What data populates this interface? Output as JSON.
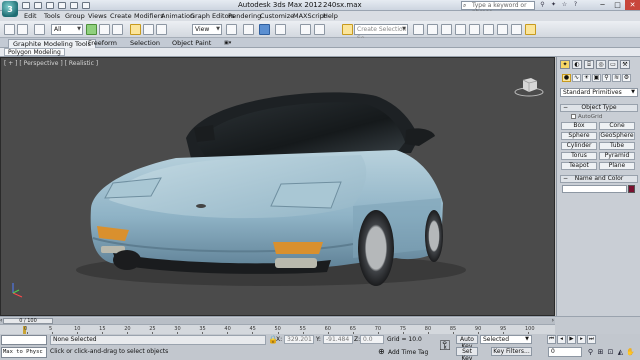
{
  "titlebar": {
    "app_title": "Autodesk 3ds Max 2012",
    "file_title": "240sx.max",
    "search_placeholder": "Type a keyword or phrase"
  },
  "menu": [
    "Edit",
    "Tools",
    "Group",
    "Views",
    "Create",
    "Modifiers",
    "Animation",
    "Graph Editors",
    "Rendering",
    "Customize",
    "MAXScript",
    "Help"
  ],
  "toolbar": {
    "filter_value": "All",
    "refcoord_value": "View",
    "named_selection_placeholder": "Create Selection Se"
  },
  "ribbon": {
    "tabs": [
      "Graphite Modeling Tools",
      "Freeform",
      "Selection",
      "Object Paint"
    ],
    "sub_label": "Polygon Modeling"
  },
  "viewport": {
    "label": "[ + ] [ Perspective ] [ Realistic ]",
    "car_color": "#8fb5c8"
  },
  "command_panel": {
    "category": "Standard Primitives",
    "object_type_header": "Object Type",
    "autogrid_label": "AutoGrid",
    "buttons": [
      "Box",
      "Cone",
      "Sphere",
      "GeoSphere",
      "Cylinder",
      "Tube",
      "Torus",
      "Pyramid",
      "Teapot",
      "Plane"
    ],
    "name_color_header": "Name and Color",
    "object_color": "#7a1030"
  },
  "timeline": {
    "slider_label": "0 / 100",
    "ticks": [
      "0",
      "5",
      "10",
      "15",
      "20",
      "25",
      "30",
      "35",
      "40",
      "45",
      "50",
      "55",
      "60",
      "65",
      "70",
      "75",
      "80",
      "85",
      "90",
      "95",
      "100"
    ]
  },
  "status": {
    "maxscript_label": "Max to Physc",
    "selection_status": "None Selected",
    "hint": "Click or click-and-drag to select objects",
    "x_label": "X:",
    "x_value": "329.201",
    "y_label": "Y:",
    "y_value": "-91.484",
    "z_label": "Z:",
    "z_value": "0.0",
    "grid": "Grid = 10.0",
    "add_time_tag": "Add Time Tag",
    "auto_key": "Auto Key",
    "set_key": "Set Key",
    "key_mode_value": "Selected",
    "key_filters": "Key Filters...",
    "current_frame": "0"
  }
}
